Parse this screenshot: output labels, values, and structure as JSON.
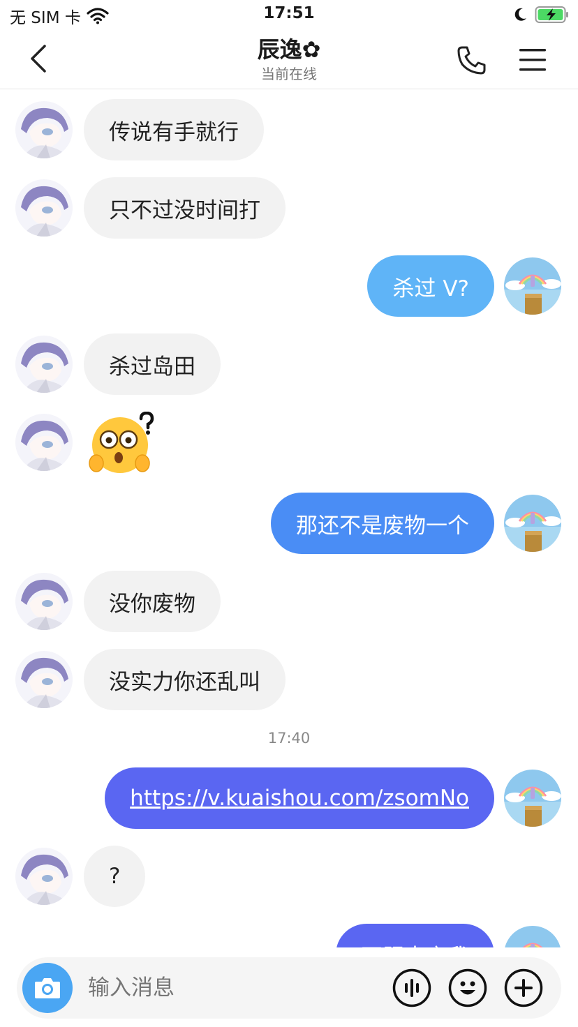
{
  "status_bar": {
    "carrier": "无 SIM 卡",
    "time": "17:51"
  },
  "header": {
    "title": "辰逸✿",
    "subtitle": "当前在线"
  },
  "messages": [
    {
      "from": "them",
      "text": "传说有手就行"
    },
    {
      "from": "them",
      "text": "只不过没时间打"
    },
    {
      "from": "me",
      "text": "杀过 V?"
    },
    {
      "from": "them",
      "text": "杀过岛田"
    },
    {
      "from": "them",
      "sticker": "confused-face-sticker"
    },
    {
      "from": "me",
      "text": "那还不是废物一个"
    },
    {
      "from": "them",
      "text": "没你废物"
    },
    {
      "from": "them",
      "text": "没实力你还乱叫"
    },
    {
      "from": "me",
      "text": "https://v.kuaishou.com/zsomNo",
      "link": true
    },
    {
      "from": "them",
      "text": "?"
    },
    {
      "from": "me",
      "text": "不服来守我"
    }
  ],
  "timestamp": "17:40",
  "input": {
    "placeholder": "输入消息"
  },
  "colors": {
    "bubble_light": "#5fb4f7",
    "bubble_mid": "#4a8df5",
    "bubble_deep": "#5a66f2",
    "incoming_bubble": "#f2f2f2",
    "camera_button": "#4aa6f3"
  }
}
